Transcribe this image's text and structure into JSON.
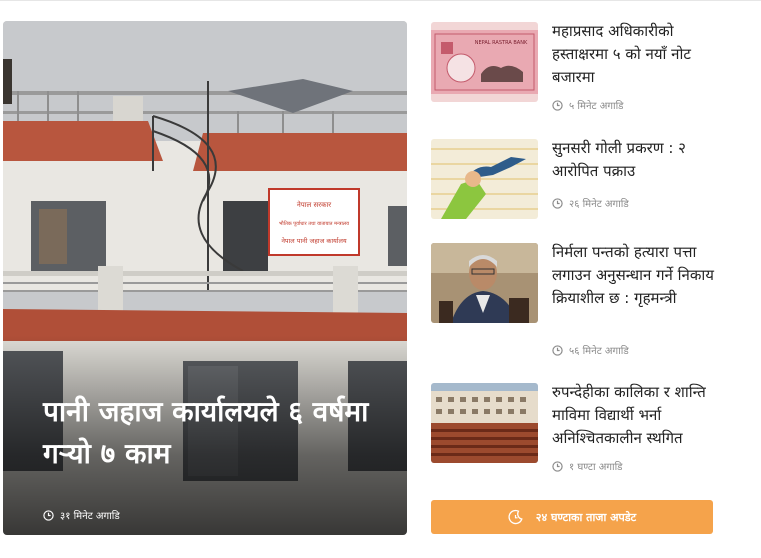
{
  "featured": {
    "headline": "पानी जहाज कार्यालयले ६ वर्षमा गर्‍यो ७ काम",
    "time": "३१ मिनेट अगाडि",
    "sign_line1": "नेपाल सरकार",
    "sign_line2": "भौतिक पूर्वाधार तथा यातायात मन्त्रालय",
    "sign_line3": "नेपाल पानी जहाज कार्यालय",
    "icon": "clock-icon"
  },
  "news": [
    {
      "title": "महाप्रसाद अधिकारीको हस्ताक्षरमा ५ को नयाँ नोट बजारमा",
      "time": "५ मिनेट अगाडि",
      "thumb": "banknote",
      "thumb_text": "NEPAL RASTRA BANK"
    },
    {
      "title": "सुनसरी गोली प्रकरण : २ आरोपित पक्राउ",
      "time": "२६ मिनेट अगाडि",
      "thumb": "gun-illustration"
    },
    {
      "title": "निर्मला पन्तको हत्यारा पत्ता लगाउन अनुसन्धान गर्ने निकाय क्रियाशील छ : गृहमन्त्री",
      "time": "५६ मिनेट अगाडि",
      "thumb": "minister-portrait"
    },
    {
      "title": "रुपन्देहीका कालिका र शान्ति माविमा विद्यार्थी भर्ना अनिश्चितकालीन स्थगित",
      "time": "१ घण्टा अगाडि",
      "thumb": "school-assembly"
    }
  ],
  "update_button": {
    "label": "२४ घण्टाका ताजा अपडेट",
    "icon": "moon-clock-icon"
  },
  "colors": {
    "accent": "#f5a34b",
    "meta_text": "#8a8a8a"
  }
}
